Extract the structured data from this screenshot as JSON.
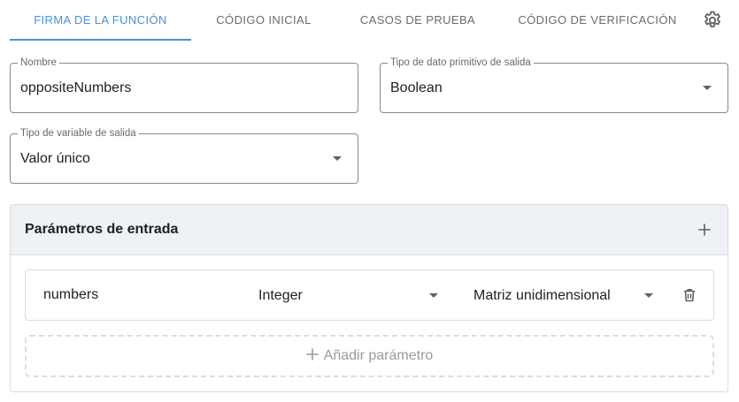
{
  "tabs": [
    {
      "label": "Firma de la función",
      "active": true
    },
    {
      "label": "Código inicial",
      "active": false
    },
    {
      "label": "Casos de prueba",
      "active": false
    },
    {
      "label": "Código de verificación",
      "active": false
    }
  ],
  "form": {
    "name": {
      "label": "Nombre",
      "value": "oppositeNumbers"
    },
    "output_primitive": {
      "label": "Tipo de dato primitivo de salida",
      "value": "Boolean"
    },
    "output_variable": {
      "label": "Tipo de variable de salida",
      "value": "Valor único"
    }
  },
  "parameters": {
    "title": "Parámetros de entrada",
    "rows": [
      {
        "name": "numbers",
        "type": "Integer",
        "structure": "Matriz unidimensional"
      }
    ],
    "add_label": "Añadir parámetro"
  },
  "colors": {
    "accent": "#4a90d9",
    "panel_header_bg": "#eef1f5"
  },
  "icons": {
    "settings": "gear-icon",
    "add": "plus-icon",
    "delete": "trash-icon",
    "dropdown": "caret-down-icon"
  }
}
